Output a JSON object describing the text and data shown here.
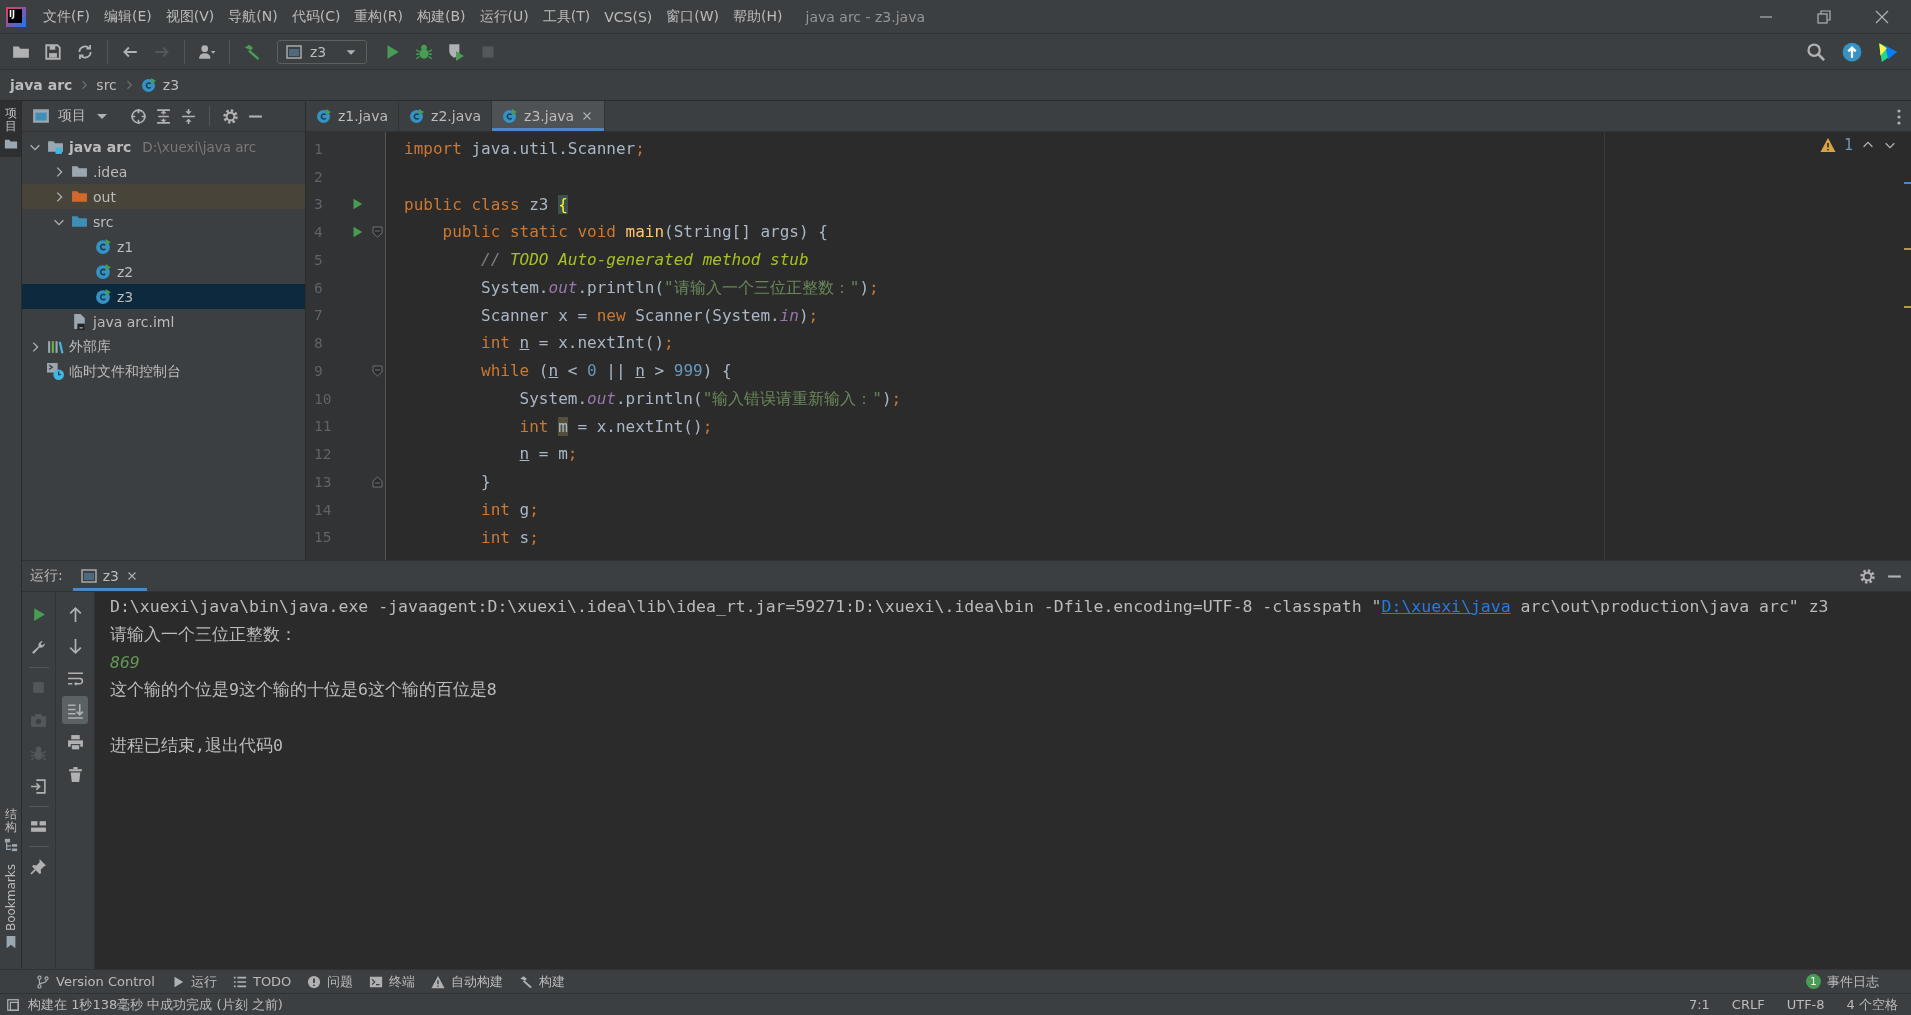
{
  "window": {
    "logo_text": "IJ",
    "title": "java arc - z3.java"
  },
  "menu": [
    "文件(F)",
    "编辑(E)",
    "视图(V)",
    "导航(N)",
    "代码(C)",
    "重构(R)",
    "构建(B)",
    "运行(U)",
    "工具(T)",
    "VCS(S)",
    "窗口(W)",
    "帮助(H)"
  ],
  "toolbar": {
    "groups": [
      [
        {
          "kind": "open",
          "disabled": false
        },
        {
          "kind": "save",
          "disabled": false
        },
        {
          "kind": "sync",
          "disabled": false
        }
      ],
      [
        {
          "kind": "back",
          "disabled": false
        },
        {
          "kind": "forward",
          "disabled": true
        }
      ],
      [
        {
          "kind": "user",
          "disabled": false
        }
      ],
      [
        {
          "kind": "build",
          "disabled": false
        },
        {
          "kind": "run-config",
          "label": "z3"
        },
        {
          "kind": "run",
          "disabled": false
        },
        {
          "kind": "debug",
          "disabled": false
        },
        {
          "kind": "coverage",
          "disabled": false
        },
        {
          "kind": "stop",
          "disabled": true
        }
      ]
    ],
    "right": [
      {
        "kind": "search"
      },
      {
        "kind": "update"
      },
      {
        "kind": "logo"
      }
    ]
  },
  "breadcrumb": [
    {
      "label": "java arc",
      "kind": "module"
    },
    {
      "label": "src",
      "kind": "folder"
    },
    {
      "label": "z3",
      "kind": "class"
    }
  ],
  "left_stripe": [
    {
      "label": "项目",
      "kind": "project",
      "selected": true
    },
    {
      "label": "结构",
      "kind": "structure",
      "selected": false
    },
    {
      "label": "Bookmarks",
      "kind": "bookmarks",
      "selected": false
    }
  ],
  "project_panel": {
    "title": "项目",
    "tree": [
      {
        "label": "java arc",
        "hint": "D:\\xuexi\\java arc",
        "kind": "module",
        "expanded": true,
        "selected": false,
        "children": [
          {
            "label": ".idea",
            "kind": "folder",
            "expanded": false,
            "selected": false
          },
          {
            "label": "out",
            "kind": "excluded-folder",
            "expanded": false,
            "selected": false
          },
          {
            "label": "src",
            "kind": "source-folder",
            "expanded": true,
            "selected": false,
            "children": [
              {
                "label": "z1",
                "kind": "class",
                "selected": false
              },
              {
                "label": "z2",
                "kind": "class",
                "selected": false
              },
              {
                "label": "z3",
                "kind": "class",
                "selected": true
              }
            ]
          },
          {
            "label": "java arc.iml",
            "kind": "module-file",
            "selected": false
          }
        ]
      },
      {
        "label": "外部库",
        "kind": "library",
        "expanded": false,
        "selected": false
      },
      {
        "label": "临时文件和控制台",
        "kind": "scratches",
        "selected": false
      }
    ]
  },
  "editor": {
    "tabs": [
      {
        "label": "z1.java",
        "selected": false
      },
      {
        "label": "z2.java",
        "selected": false
      },
      {
        "label": "z3.java",
        "selected": true
      }
    ],
    "warning_count": "1",
    "lines": [
      {
        "number": "1",
        "run_marker": false,
        "fold_start": false,
        "fold_end": false,
        "tokens": [
          {
            "kind": "kw",
            "text": "import"
          },
          {
            "kind": "plain",
            "text": " java.util.Scanner"
          },
          {
            "kind": "semi",
            "text": ";"
          }
        ]
      },
      {
        "number": "2",
        "run_marker": false,
        "fold_start": false,
        "fold_end": false
      },
      {
        "number": "3",
        "run_marker": true,
        "fold_start": false,
        "fold_end": false,
        "tokens": [
          {
            "kind": "kw",
            "text": "public class"
          },
          {
            "kind": "plain",
            "text": " z3 "
          },
          {
            "kind": "brace-match",
            "text": "{"
          }
        ]
      },
      {
        "number": "4",
        "run_marker": true,
        "fold_start": true,
        "fold_end": false,
        "tokens": [
          {
            "kind": "kw",
            "text": "    public static void"
          },
          {
            "kind": "method",
            "text": " main"
          },
          {
            "kind": "plain",
            "text": "(String[] args) {"
          }
        ]
      },
      {
        "number": "5",
        "run_marker": false,
        "fold_start": false,
        "fold_end": false,
        "tokens": [
          {
            "kind": "comment",
            "text": "        // "
          },
          {
            "kind": "todo",
            "text": "TODO Auto-generated method stub"
          }
        ]
      },
      {
        "number": "6",
        "run_marker": false,
        "fold_start": false,
        "fold_end": false,
        "tokens": [
          {
            "kind": "plain",
            "text": "        System."
          },
          {
            "kind": "field",
            "text": "out"
          },
          {
            "kind": "plain",
            "text": ".println("
          },
          {
            "kind": "str",
            "text": "\"请输入一个三位正整数：\""
          },
          {
            "kind": "plain",
            "text": ")"
          },
          {
            "kind": "semi",
            "text": ";"
          }
        ]
      },
      {
        "number": "7",
        "run_marker": false,
        "fold_start": false,
        "fold_end": false,
        "tokens": [
          {
            "kind": "plain",
            "text": "        Scanner x = "
          },
          {
            "kind": "kw",
            "text": "new"
          },
          {
            "kind": "plain",
            "text": " Scanner(System."
          },
          {
            "kind": "field",
            "text": "in"
          },
          {
            "kind": "plain",
            "text": ")"
          },
          {
            "kind": "semi",
            "text": ";"
          }
        ]
      },
      {
        "number": "8",
        "run_marker": false,
        "fold_start": false,
        "fold_end": false,
        "tokens": [
          {
            "kind": "kw",
            "text": "        int "
          },
          {
            "kind": "var",
            "text": "n"
          },
          {
            "kind": "plain",
            "text": " = x.nextInt()"
          },
          {
            "kind": "semi",
            "text": ";"
          }
        ]
      },
      {
        "number": "9",
        "run_marker": false,
        "fold_start": true,
        "fold_end": false,
        "tokens": [
          {
            "kind": "kw",
            "text": "        while"
          },
          {
            "kind": "plain",
            "text": " ("
          },
          {
            "kind": "var",
            "text": "n"
          },
          {
            "kind": "plain",
            "text": " < "
          },
          {
            "kind": "num",
            "text": "0"
          },
          {
            "kind": "plain",
            "text": " || "
          },
          {
            "kind": "var",
            "text": "n"
          },
          {
            "kind": "plain",
            "text": " > "
          },
          {
            "kind": "num",
            "text": "999"
          },
          {
            "kind": "plain",
            "text": ") {"
          }
        ]
      },
      {
        "number": "10",
        "run_marker": false,
        "fold_start": false,
        "fold_end": false,
        "tokens": [
          {
            "kind": "plain",
            "text": "            System."
          },
          {
            "kind": "field",
            "text": "out"
          },
          {
            "kind": "plain",
            "text": ".println("
          },
          {
            "kind": "str",
            "text": "\"输入错误请重新输入：\""
          },
          {
            "kind": "plain",
            "text": ")"
          },
          {
            "kind": "semi",
            "text": ";"
          }
        ]
      },
      {
        "number": "11",
        "run_marker": false,
        "fold_start": false,
        "fold_end": false,
        "tokens": [
          {
            "kind": "kw",
            "text": "            int "
          },
          {
            "kind": "usage",
            "text": "m"
          },
          {
            "kind": "plain",
            "text": " = x.nextInt()"
          },
          {
            "kind": "semi",
            "text": ";"
          }
        ]
      },
      {
        "number": "12",
        "run_marker": false,
        "fold_start": false,
        "fold_end": false,
        "tokens": [
          {
            "kind": "var",
            "text": "            n"
          },
          {
            "kind": "plain",
            "text": " = m"
          },
          {
            "kind": "semi",
            "text": ";"
          }
        ]
      },
      {
        "number": "13",
        "run_marker": false,
        "fold_start": false,
        "fold_end": true,
        "tokens": [
          {
            "kind": "plain",
            "text": "        }"
          }
        ]
      },
      {
        "number": "14",
        "run_marker": false,
        "fold_start": false,
        "fold_end": false,
        "tokens": [
          {
            "kind": "kw",
            "text": "        int"
          },
          {
            "kind": "plain",
            "text": " g"
          },
          {
            "kind": "semi",
            "text": ";"
          }
        ]
      },
      {
        "number": "15",
        "run_marker": false,
        "fold_start": false,
        "fold_end": false,
        "tokens": [
          {
            "kind": "kw",
            "text": "        int"
          },
          {
            "kind": "plain",
            "text": " s"
          },
          {
            "kind": "semi",
            "text": ";"
          }
        ]
      }
    ]
  },
  "run_panel": {
    "label": "运行:",
    "tabs": [
      {
        "label": "z3",
        "selected": true
      }
    ],
    "left_tools": [
      [
        {
          "kind": "run",
          "disabled": false
        },
        {
          "kind": "wrench",
          "disabled": false
        }
      ],
      [
        {
          "kind": "stop",
          "disabled": true
        },
        {
          "kind": "camera",
          "disabled": true
        },
        {
          "kind": "debug",
          "disabled": true
        },
        {
          "kind": "exit",
          "disabled": false
        }
      ],
      [
        {
          "kind": "layout",
          "disabled": false
        }
      ],
      [
        {
          "kind": "pin",
          "disabled": false
        }
      ]
    ],
    "right_tools": [
      {
        "kind": "up",
        "selected": false
      },
      {
        "kind": "down",
        "selected": false
      },
      {
        "kind": "wrap",
        "selected": false
      },
      {
        "kind": "scroll-end",
        "selected": true
      },
      {
        "kind": "print",
        "selected": false
      },
      {
        "kind": "trash",
        "selected": false
      }
    ],
    "console": [
      {
        "kind": "command",
        "parts": [
          {
            "text": "D:\\xuexi\\java\\bin\\java.exe -javaagent:D:\\xuexi\\.idea\\lib\\idea_rt.jar=59271:D:\\xuexi\\.idea\\bin -Dfile.encoding=UTF-8 -classpath \"",
            "link": false
          },
          {
            "text": "D:\\xuexi\\java",
            "link": true
          },
          {
            "text": " arc\\out\\production\\java arc\" z3",
            "link": false
          }
        ]
      },
      {
        "kind": "output",
        "text": "请输入一个三位正整数："
      },
      {
        "kind": "input",
        "text": "869"
      },
      {
        "kind": "output",
        "text": "这个输的个位是9这个输的十位是6这个输的百位是8"
      },
      {
        "kind": "exit",
        "text": "进程已结束,退出代码0"
      }
    ]
  },
  "tool_windows": [
    {
      "label": "Version Control",
      "kind": "vcs"
    },
    {
      "label": "运行",
      "kind": "run"
    },
    {
      "label": "TODO",
      "kind": "todo"
    },
    {
      "label": "问题",
      "kind": "problems"
    },
    {
      "label": "终端",
      "kind": "terminal"
    },
    {
      "label": "自动构建",
      "kind": "auto-build"
    },
    {
      "label": "构建",
      "kind": "build"
    }
  ],
  "event_log": {
    "count": "1",
    "label": "事件日志"
  },
  "status_bar": {
    "message": "构建在 1秒138毫秒 中成功完成 (片刻 之前)",
    "items": [
      "7:1",
      "CRLF",
      "UTF-8",
      "4 个空格"
    ]
  }
}
